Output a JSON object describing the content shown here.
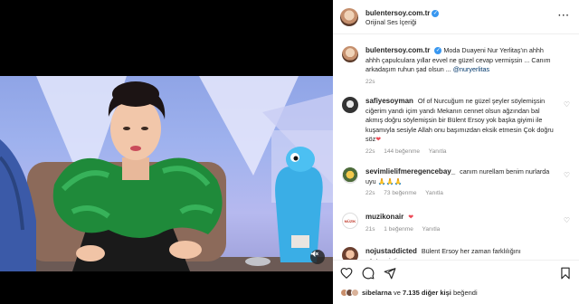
{
  "post": {
    "author": "bulentersoy.com.tr",
    "audio": "Orijinal Ses İçeriği"
  },
  "caption": {
    "author": "bulentersoy.com.tr",
    "text": "Moda Duayeni Nur Yerlitaş'ın ahhh ahhh çapulculara yıllar evvel ne güzel cevap vermişsin ... Canım arkadaşım ruhun şad olsun ... ",
    "mention": "@nuryerlitas",
    "time": "22s"
  },
  "comments": [
    {
      "author": "safiyesoyman",
      "text": "Of of Nurcuğum ne güzel şeyler söylemişsin ciğerim yandı içim yandı Mekanın cennet olsun ağzından bal akmış doğru söylemişsin bir Bülent Ersoy yok başka giyimi ile kuşamıyla sesiyle Allah onu başımızdan eksik etmesin Çok doğru söz",
      "emoji": "❤",
      "time": "22s",
      "likes": "144 beğenme",
      "reply": "Yanıtla"
    },
    {
      "author": "sevimlielifmeregencebay_",
      "text": "canım nurellam benim nurlarda uyu ",
      "emoji": "🙏🙏🙏",
      "time": "22s",
      "likes": "73 beğenme",
      "reply": "Yanıtla"
    },
    {
      "author": "muzikonair",
      "text": "",
      "emoji": "❤",
      "time": "21s",
      "likes": "1 beğenme",
      "reply": "Yanıtla"
    },
    {
      "author": "nojustaddicted",
      "text": "Bülent Ersoy her zaman farklılığını göstermiştir"
    }
  ],
  "likes": {
    "user": "sibelarna",
    "connector": "ve",
    "count": "7.135 diğer kişi",
    "suffix": "beğendi"
  },
  "icons": [
    "heart-icon",
    "comment-icon",
    "share-icon",
    "bookmark-icon",
    "more-icon",
    "mute-icon",
    "verified-icon"
  ],
  "colors": {
    "verified": "#3897f0",
    "like_red": "#ed4956",
    "link": "#00376b",
    "muted": "#8e8e8e"
  }
}
